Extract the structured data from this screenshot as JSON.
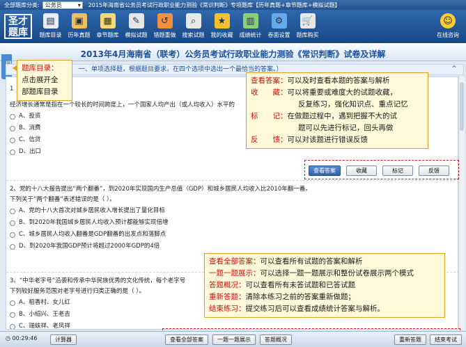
{
  "topbar": {
    "category_label": "全部题库分类:",
    "category_value": "公务员",
    "title": "2015年海南省公务员考试行政职业能力测验《常识判断》专项题库【历年真题+章节题库+模拟试题】"
  },
  "logo": {
    "line1": "圣才",
    "line2": "题库"
  },
  "toolbar": [
    {
      "label": "题库目录",
      "icon": "▤",
      "color": "#e8edf6"
    },
    {
      "label": "历年真题",
      "icon": "▣",
      "color": "#f0c060"
    },
    {
      "label": "章节题库",
      "icon": "▦",
      "color": "#f5d878"
    },
    {
      "label": "模拟试题",
      "icon": "✎",
      "color": "#e6e6e6"
    },
    {
      "label": "错题重做",
      "icon": "↺",
      "color": "#f09040"
    },
    {
      "label": "搜索试题",
      "icon": "⌕",
      "color": "#e8e8e8"
    },
    {
      "label": "我的收藏",
      "icon": "★",
      "color": "#f5c030"
    },
    {
      "label": "成绩统计",
      "icon": "▥",
      "color": "#8ad070"
    },
    {
      "label": "卷面设置",
      "icon": "⚙",
      "color": "#66aaee"
    },
    {
      "label": "题库购买",
      "icon": "🛒",
      "color": "#e8e8e8"
    }
  ],
  "chat": {
    "label": "在线咨询",
    "icon": "☺"
  },
  "side_tab": "目录",
  "page_title": "2013年4月海南省（联考）公务员考试行政职业能力测验《常识判断》试卷及详解",
  "instruction": "一、单项选择题，根据题目要求，在四个选项中选出一个最恰当的答案。）",
  "collapse_icon": "⌃",
  "q1": {
    "num": "1",
    "stem": "经济增长通常是指在一个较长的时间跨度上，一个国家人均产出（或人均收入）水平的",
    "options": [
      "A、投资",
      "B、消费",
      "C、信贷",
      "D、出口"
    ],
    "buttons": [
      "查看答案",
      "收藏",
      "标记",
      "反馈"
    ]
  },
  "q2": {
    "line1": "2、党的十八大报告提出“两个翻番”，到2020年实现国内生产总值（GDP）和城乡居民人均收入比2010年翻一番。",
    "line2": "下列关于“两个翻番”表述错误的是（    ）。",
    "options": [
      "A、党的十八大首次对城乡居民收入增长提出了量化目标",
      "B、到2020年我国城乡居民人均收入预计都能够实现倍增",
      "C、城乡居民人均收入翻番是GDP翻番的出发点和落脚点",
      "D、到2020年我国GDP预计将超过2000年GDP的4倍"
    ]
  },
  "q3": {
    "line1": "3、“中华老字号”沿袭和传承中华民族优秀的文化传统，每个老字号",
    "line2": "下列较好服务范围对老字号进行归类正确的是（    ）。",
    "options": [
      "A、稻香村、女儿红",
      "B、小绍兴、王老吉",
      "C、瑞蚨祥、老凤祥"
    ]
  },
  "tip_catalog": {
    "l1": "题库目录：",
    "l2": "点击展开全",
    "l3": "部题库目录"
  },
  "tip_answer": {
    "rows": [
      {
        "k": "查看答案：",
        "v": "可以及时查看本题的答案与解析"
      },
      {
        "k": "收　　藏：",
        "v": "可以将重要或难度大的试题收藏，"
      },
      {
        "k": "",
        "v": "反复练习，强化知识点、重点记忆"
      },
      {
        "k": "标　　记：",
        "v": "在做题过程中，遇到把握不大的试"
      },
      {
        "k": "",
        "v": "题可以先进行标记，回头再做"
      },
      {
        "k": "反　　馈：",
        "v": "可以对该题进行错误反馈"
      }
    ]
  },
  "tip_bottom": {
    "rows": [
      {
        "k": "查看全部答案：",
        "v": "可以查看所有试题的答案和解析"
      },
      {
        "k": "一题一题展示：",
        "v": "可以选择一题一题展示和整份试卷展示两个模式"
      },
      {
        "k": "答题概况：",
        "v": "可以查看所有未答试题和已答试题"
      },
      {
        "k": "重新答题：",
        "v": "清除本练习之前的答案重新做题；"
      },
      {
        "k": "结束练习：",
        "v": "提交练习后可以查看成绩统计答案与解析。"
      }
    ]
  },
  "bottom": {
    "clock": "00:29:46",
    "calculator": "计算器",
    "show_all": "查看全部答案",
    "one_by_one": "一题一题展示",
    "overview": "答题概况",
    "restart": "重新答题",
    "finish": "结束考试"
  }
}
